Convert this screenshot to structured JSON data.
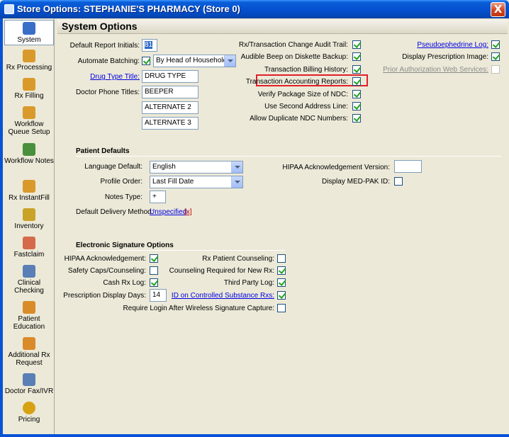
{
  "window": {
    "title": "Store Options: STEPHANIE'S PHARMACY (Store 0)",
    "close": "X"
  },
  "nav": {
    "items": [
      {
        "label": "System",
        "color": "#3a6fc8"
      },
      {
        "label": "Rx Processing",
        "color": "#d99a2b"
      },
      {
        "label": "Rx Filling",
        "color": "#d99a2b"
      },
      {
        "label": "Workflow Queue Setup",
        "color": "#d99a2b"
      },
      {
        "label": "Workflow Notes",
        "color": "#4a8f3c"
      },
      {
        "label": "Rx InstantFill",
        "color": "#d99a2b"
      },
      {
        "label": "Inventory",
        "color": "#c9a327"
      },
      {
        "label": "Fastclaim",
        "color": "#d46a4a"
      },
      {
        "label": "Clinical Checking",
        "color": "#5a7fb6"
      },
      {
        "label": "Patient Education",
        "color": "#d98b2a"
      },
      {
        "label": "Additional Rx Request",
        "color": "#d98b2a"
      },
      {
        "label": "Doctor Fax/IVR",
        "color": "#5a7fb6"
      },
      {
        "label": "Pricing",
        "color": "#d6a214"
      }
    ]
  },
  "header": {
    "title": "System Options"
  },
  "system": {
    "default_report_initials_label": "Default Report Initials:",
    "default_report_initials_value": "81",
    "automate_batching_label": "Automate Batching:",
    "automate_batching_value": "By Head of Household",
    "drug_type_title_label": "Drug Type Title:",
    "drug_type_title_value": "DRUG TYPE",
    "doctor_phone_titles_label": "Doctor Phone Titles:",
    "doctor_phone_titles": [
      "BEEPER",
      "ALTERNATE 2",
      "ALTERNATE 3"
    ],
    "audit_trail_label": "Rx/Transaction Change Audit Trail:",
    "audible_beep_label": "Audible Beep on Diskette Backup:",
    "billing_history_label": "Transaction Billing History:",
    "accounting_reports_label": "Transaction Accounting Reports:",
    "verify_package_label": "Verify Package Size of NDC:",
    "second_address_label": "Use Second Address Line:",
    "duplicate_ndc_label": "Allow Duplicate NDC Numbers:",
    "pseudoephedrine_label": "Pseudoephedrine Log:",
    "display_image_label": "Display Prescription Image:",
    "prior_auth_label": "Prior Authorization Web Services:"
  },
  "patient_defaults": {
    "section_title": "Patient Defaults",
    "language_label": "Language Default:",
    "language_value": "English",
    "profile_order_label": "Profile Order:",
    "profile_order_value": "Last Fill Date",
    "notes_type_label": "Notes Type:",
    "notes_type_value": "+",
    "delivery_label": "Default Delivery Method:",
    "delivery_value": "Unspecified",
    "delivery_clear": "[x]",
    "hipaa_version_label": "HIPAA Acknowledgement Version:",
    "hipaa_version_value": "",
    "medpak_label": "Display MED-PAK ID:"
  },
  "esig": {
    "section_title": "Electronic Signature Options",
    "hipaa_ack_label": "HIPAA Acknowledgement:",
    "safety_caps_label": "Safety Caps/Counseling:",
    "cash_rx_label": "Cash Rx Log:",
    "display_days_label": "Prescription Display Days:",
    "display_days_value": "14",
    "rx_counseling_label": "Rx Patient Counseling:",
    "counseling_new_label": "Counseling Required for New Rx:",
    "third_party_label": "Third Party Log:",
    "id_controlled_label": "ID on Controlled Substance Rxs:",
    "require_login_label": "Require Login After Wireless Signature Capture:"
  }
}
